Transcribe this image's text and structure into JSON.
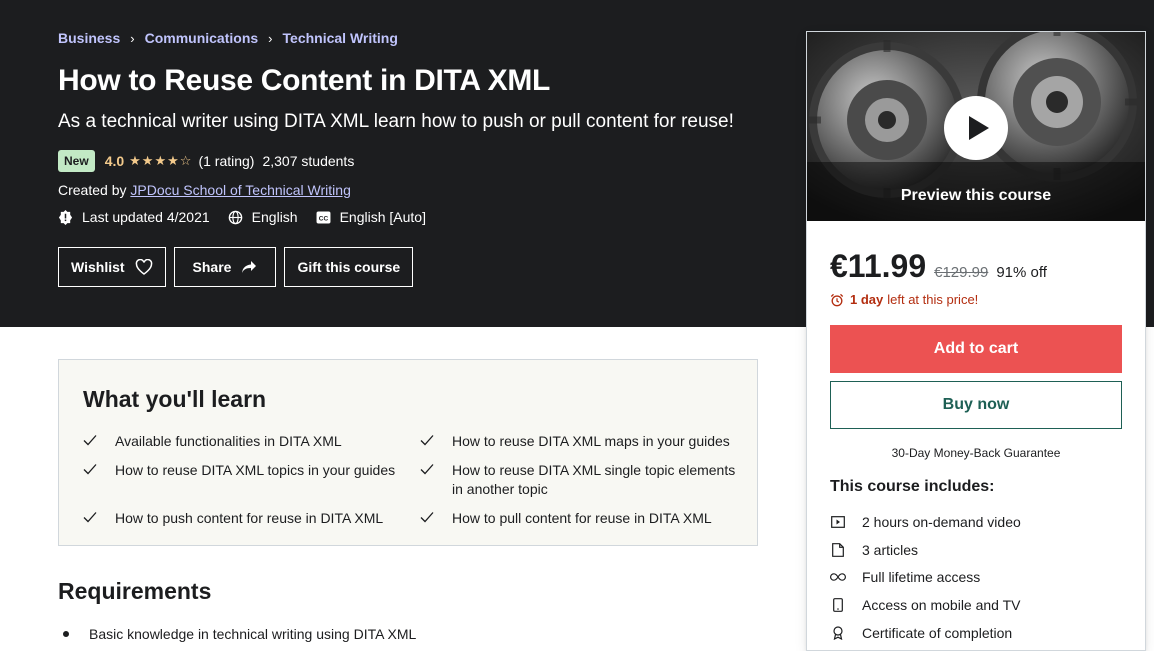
{
  "breadcrumb": [
    "Business",
    "Communications",
    "Technical Writing"
  ],
  "course": {
    "title": "How to Reuse Content in DITA XML",
    "subtitle": "As a technical writer using DITA XML learn how to push or pull content for reuse!",
    "badge": "New",
    "rating": "4.0",
    "rating_count": "(1 rating)",
    "students": "2,307 students",
    "created_by_label": "Created by",
    "author": "JPDocu School of Technical Writing",
    "last_updated": "Last updated 4/2021",
    "language": "English",
    "captions": "English [Auto]"
  },
  "actions": {
    "wishlist": "Wishlist",
    "share": "Share",
    "gift": "Gift this course"
  },
  "sidebar": {
    "preview_label": "Preview this course",
    "price": "€11.99",
    "original_price": "€129.99",
    "discount": "91% off",
    "timer_bold": "1 day",
    "timer_rest": "left at this price!",
    "add_to_cart": "Add to cart",
    "buy_now": "Buy now",
    "guarantee": "30-Day Money-Back Guarantee",
    "includes_title": "This course includes:",
    "includes": [
      {
        "icon": "video-icon",
        "label": "2 hours on-demand video"
      },
      {
        "icon": "file-icon",
        "label": "3 articles"
      },
      {
        "icon": "infinity-icon",
        "label": "Full lifetime access"
      },
      {
        "icon": "mobile-icon",
        "label": "Access on mobile and TV"
      },
      {
        "icon": "certificate-icon",
        "label": "Certificate of completion"
      }
    ]
  },
  "learn": {
    "title": "What you'll learn",
    "items": [
      "Available functionalities in DITA XML",
      "How to reuse DITA XML maps in your guides",
      "How to reuse DITA XML topics in your guides",
      "How to reuse DITA XML single topic elements in another topic",
      "How to push content for reuse in DITA XML",
      "How to pull content for reuse in DITA XML"
    ]
  },
  "requirements": {
    "title": "Requirements",
    "items": [
      "Basic knowledge in technical writing using DITA XML"
    ]
  },
  "colors": {
    "hero_bg": "#1c1d1f",
    "link": "#c0c4fc",
    "star": "#f3ca8c",
    "cart": "#ec5252",
    "buy_border": "#1e6055",
    "timer": "#b32d0f"
  }
}
